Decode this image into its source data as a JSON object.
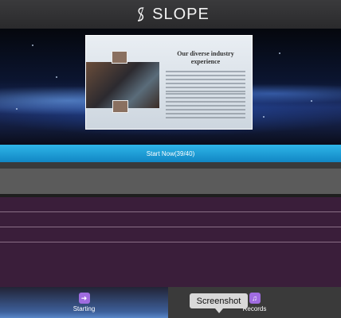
{
  "header": {
    "brand": "SLOPE",
    "logo_icon": "slope-logo-icon"
  },
  "hero": {
    "card": {
      "title": "Our diverse industry experience",
      "image_icon": "office-team-photo"
    }
  },
  "start_button": {
    "label": "Start Now(39/40)"
  },
  "tabbar": {
    "tabs": [
      {
        "label": "Starting",
        "icon": "arrow-right-icon"
      },
      {
        "label": "Records",
        "icon": "records-icon"
      }
    ],
    "tooltip": "Screenshot"
  },
  "colors": {
    "accent": "#1ea5dc",
    "purple_panel": "#3a1e3a",
    "tab_icon": "#a06ce0"
  }
}
